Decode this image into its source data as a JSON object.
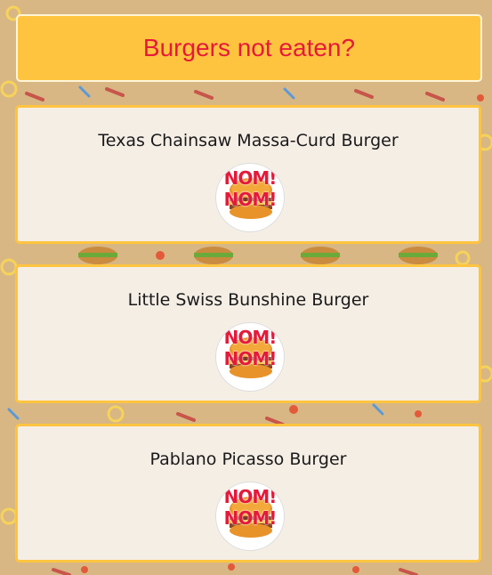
{
  "header": {
    "title": "Burgers not eaten?"
  },
  "burgers": [
    {
      "name": "Texas Chainsaw Massa-Curd Burger",
      "nom_top": "NOM!",
      "nom_bottom": "NOM!"
    },
    {
      "name": "Little Swiss Bunshine Burger",
      "nom_top": "NOM!",
      "nom_bottom": "NOM!"
    },
    {
      "name": "Pablano Picasso Burger",
      "nom_top": "NOM!",
      "nom_bottom": "NOM!"
    }
  ],
  "icons": {
    "eat_button": "burger-icon",
    "background": "food-pattern"
  },
  "colors": {
    "background": "#d8b784",
    "header_bg": "#ffc43f",
    "title_text": "#e6193a",
    "card_bg": "#f5eee5",
    "card_border": "#ffc43f",
    "nom_text": "#e6193a"
  }
}
